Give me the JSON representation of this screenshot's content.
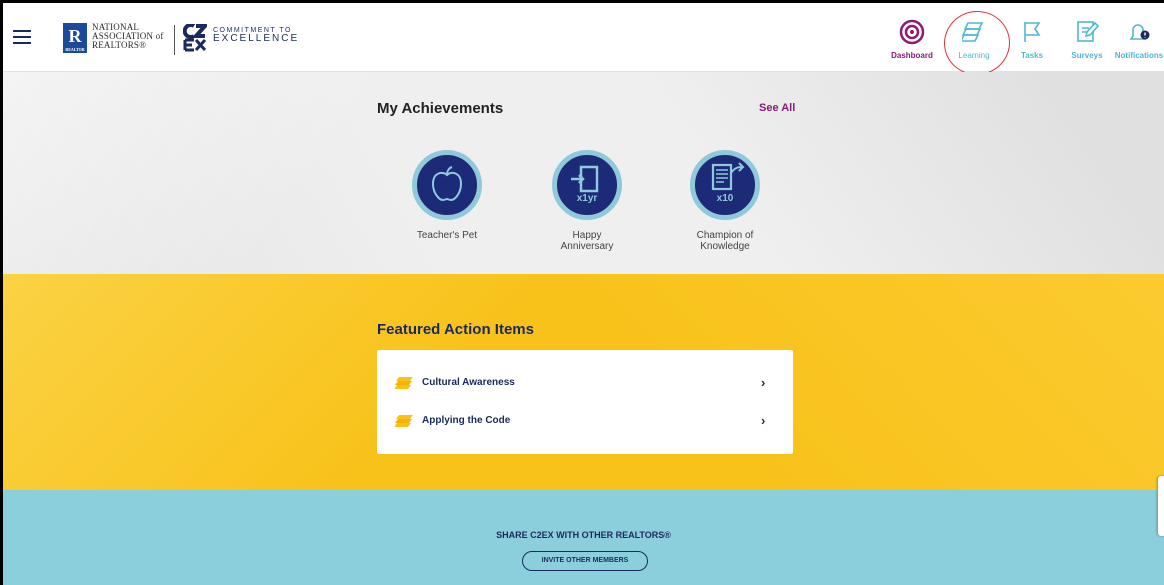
{
  "header": {
    "nar_line1": "NATIONAL",
    "nar_line2": "ASSOCIATION of",
    "nar_line3": "REALTORS®",
    "nar_mark": "R",
    "nar_sub": "REALTOR",
    "c2ex_line1": "COMMITMENT TO",
    "c2ex_line2": "EXCELLENCE"
  },
  "nav": {
    "items": [
      {
        "label": "Dashboard",
        "icon": "dashboard-icon",
        "color": "#8a1a7c"
      },
      {
        "label": "Learning",
        "icon": "learning-icon",
        "color": "#4fb8d0"
      },
      {
        "label": "Tasks",
        "icon": "flag-icon",
        "color": "#4fb8d0"
      },
      {
        "label": "Surveys",
        "icon": "survey-icon",
        "color": "#4fb8d0"
      },
      {
        "label": "Notifications",
        "icon": "bell-icon",
        "color": "#4fb8d0"
      }
    ]
  },
  "achievements": {
    "title": "My Achievements",
    "see_all": "See All",
    "badges": [
      {
        "name": "Teacher's Pet",
        "icon": "apple-icon"
      },
      {
        "name": "Happy Anniversary",
        "icon": "door-icon",
        "tag": "x1yr"
      },
      {
        "name": "Champion of Knowledge",
        "icon": "document-icon",
        "tag": "x10"
      }
    ]
  },
  "featured": {
    "title": "Featured Action Items",
    "items": [
      {
        "label": "Cultural Awareness",
        "icon": "book-icon"
      },
      {
        "label": "Applying the Code",
        "icon": "book-icon"
      }
    ]
  },
  "share": {
    "title": "SHARE C2EX WITH OTHER REALTORS®",
    "button": "INVITE OTHER MEMBERS"
  },
  "colors": {
    "navy": "#1b2a5e",
    "purple": "#8a1a7c",
    "teal": "#4fb8d0",
    "yellow": "#f8c21a",
    "light_blue": "#8bcfdc",
    "annotation_red": "#e0303a"
  }
}
